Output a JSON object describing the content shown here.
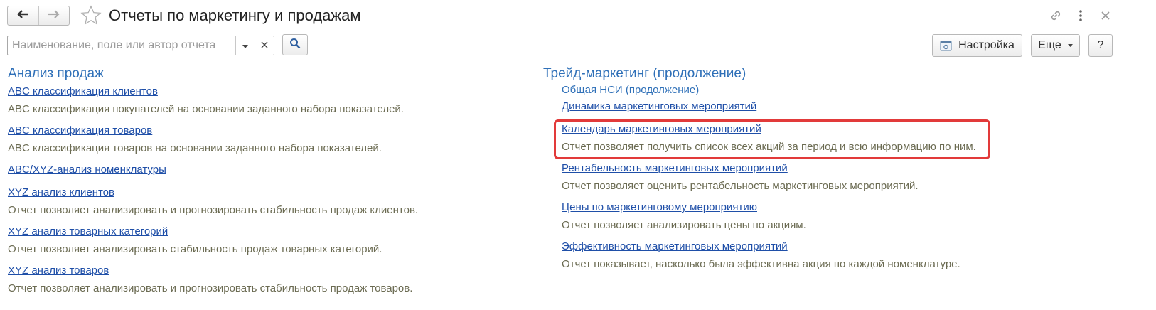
{
  "header": {
    "title": "Отчеты по маркетингу и продажам",
    "back_icon": "arrow-left-icon",
    "forward_icon": "arrow-right-icon",
    "favorite_icon": "star-icon",
    "link_icon": "link-icon",
    "more_icon": "kebab-menu-icon"
  },
  "search": {
    "placeholder": "Наименование, поле или автор отчета",
    "value": "",
    "dropdown_icon": "triangle-down-icon",
    "clear_icon": "close-icon",
    "search_icon": "magnifier-icon"
  },
  "toolbar": {
    "settings_label": "Настройка",
    "settings_icon": "settings-panel-icon",
    "more_label": "Еще",
    "help_label": "?"
  },
  "left_section": {
    "title": "Анализ продаж",
    "items": [
      {
        "link": "ABC классификация клиентов",
        "desc": "ABC классификация покупателей на основании заданного набора показателей."
      },
      {
        "link": "ABC классификация товаров",
        "desc": "ABC классификация товаров на основании заданного набора показателей."
      },
      {
        "link": "ABC/XYZ-анализ номенклатуры",
        "desc": ""
      },
      {
        "link": "XYZ анализ клиентов",
        "desc": "Отчет позволяет анализировать и прогнозировать стабильность продаж клиентов."
      },
      {
        "link": "XYZ анализ товарных категорий",
        "desc": "Отчет позволяет анализировать стабильность продаж товарных категорий."
      },
      {
        "link": "XYZ анализ товаров",
        "desc": "Отчет позволяет анализировать и прогнозировать стабильность продаж товаров."
      }
    ]
  },
  "right_section": {
    "title": "Трейд-маркетинг (продолжение)",
    "subgroup": "Общая НСИ (продолжение)",
    "items": [
      {
        "link": "Динамика маркетинговых мероприятий",
        "desc": ""
      },
      {
        "link": "Календарь маркетинговых мероприятий",
        "desc": "Отчет позволяет получить список всех акций за период и всю информацию по ним.",
        "highlighted": true
      },
      {
        "link": "Рентабельность маркетинговых мероприятий",
        "desc": "Отчет позволяет оценить рентабельность маркетинговых мероприятий."
      },
      {
        "link": "Цены по маркетинговому мероприятию",
        "desc": "Отчет позволяет анализировать цены по акциям."
      },
      {
        "link": "Эффективность маркетинговых мероприятий",
        "desc": "Отчет показывает, насколько была эффективна акция по каждой номенклатуре."
      }
    ]
  },
  "colors": {
    "section_title": "#2f70b8",
    "link": "#1f4fa8",
    "description": "#6b6b52",
    "highlight_border": "#e23a3a"
  }
}
